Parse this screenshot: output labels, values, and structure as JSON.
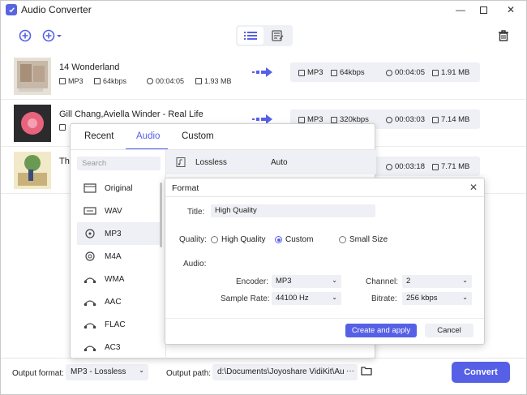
{
  "window": {
    "title": "Audio Converter"
  },
  "files": [
    {
      "name": "14 Wonderland",
      "src_format": "MP3",
      "src_bitrate": "64kbps",
      "src_duration": "00:04:05",
      "src_size": "1.93 MB",
      "out_format": "MP3",
      "out_bitrate": "64kbps",
      "out_duration": "00:04:05",
      "out_size": "1.91 MB"
    },
    {
      "name": "Gill Chang,Aviella Winder - Real Life",
      "src_format": "",
      "out_format": "MP3",
      "out_bitrate": "320kbps",
      "out_duration": "00:03:03",
      "out_size": "7.14 MB"
    },
    {
      "name": "Th",
      "out_duration": "00:03:18",
      "out_size": "7.71 MB"
    }
  ],
  "popup": {
    "tabs": [
      "Recent",
      "Audio",
      "Custom"
    ],
    "search_placeholder": "Search",
    "formats": [
      "Original",
      "WAV",
      "MP3",
      "M4A",
      "WMA",
      "AAC",
      "FLAC",
      "AC3"
    ],
    "selected_format": "MP3",
    "preset_name": "Lossless",
    "preset_value": "Auto"
  },
  "dialog": {
    "title": "Format",
    "title_label": "Title:",
    "title_value": "High Quality",
    "quality_label": "Quality:",
    "quality_options": [
      "High Quality",
      "Custom",
      "Small Size"
    ],
    "quality_selected": "Custom",
    "audio_label": "Audio:",
    "encoder_label": "Encoder:",
    "encoder_value": "MP3",
    "sample_rate_label": "Sample Rate:",
    "sample_rate_value": "44100 Hz",
    "channel_label": "Channel:",
    "channel_value": "2",
    "bitrate_label": "Bitrate:",
    "bitrate_value": "256 kbps",
    "apply_label": "Create and apply",
    "cancel_label": "Cancel"
  },
  "bottom": {
    "output_format_label": "Output format:",
    "output_format_value": "MP3 - Lossless",
    "output_path_label": "Output path:",
    "output_path_value": "d:\\Documents\\Joyoshare VidiKit\\Audio",
    "more_label": "···",
    "convert_label": "Convert"
  },
  "colors": {
    "accent": "#5660e6",
    "panel": "#eef0f5"
  }
}
